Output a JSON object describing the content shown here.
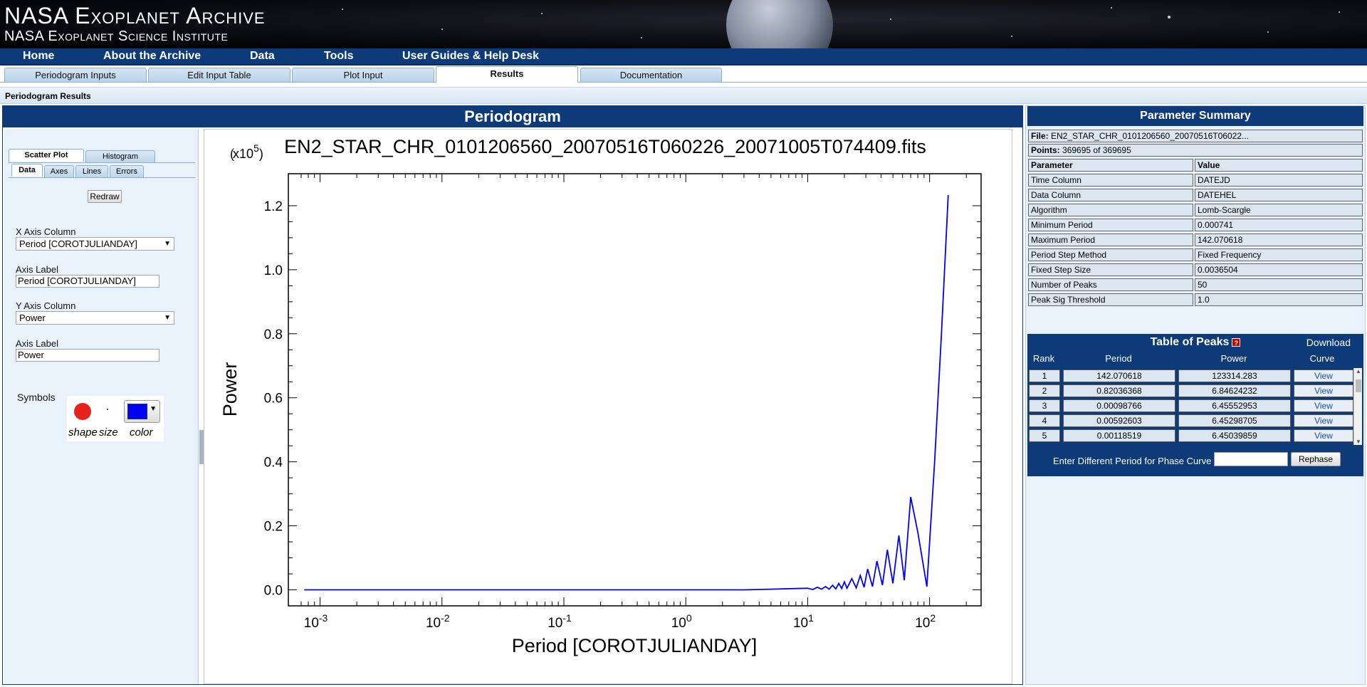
{
  "banner": {
    "title": "NASA Exoplanet Archive",
    "subtitle": "NASA Exoplanet Science Institute"
  },
  "nav": [
    "Home",
    "About the Archive",
    "Data",
    "Tools",
    "User Guides & Help Desk"
  ],
  "tabs": [
    "Periodogram Inputs",
    "Edit Input Table",
    "Plot Input",
    "Results",
    "Documentation"
  ],
  "active_tab": "Results",
  "subheader": "Periodogram Results",
  "periodogram": {
    "title": "Periodogram",
    "plot_tabs": [
      "Scatter Plot",
      "Histogram"
    ],
    "sub_tabs": [
      "Data",
      "Axes",
      "Lines",
      "Errors"
    ],
    "redraw": "Redraw",
    "x_axis_column_label": "X Axis Column",
    "x_axis_column_value": "Period [COROTJULIANDAY]",
    "x_axis_label_label": "Axis Label",
    "x_axis_label_value": "Period [COROTJULIANDAY]",
    "y_axis_column_label": "Y Axis Column",
    "y_axis_column_value": "Power",
    "y_axis_label_label": "Axis Label",
    "y_axis_label_value": "Power",
    "symbols_label": "Symbols",
    "sym_shape": "shape",
    "sym_size": "size",
    "sym_color": "color",
    "symbol_color": "#0000ff"
  },
  "chart_data": {
    "type": "line",
    "title": "EN2_STAR_CHR_0101206560_20070516T060226_20071005T074409.fits",
    "xlabel": "Period [COROTJULIANDAY]",
    "ylabel": "Power",
    "y_scale_base": "x10",
    "y_scale_exp": "5",
    "x_scale": "log",
    "xlim": [
      0.000741,
      142.070618
    ],
    "ylim": [
      -0.05,
      1.3
    ],
    "x_ticks": [
      "-3",
      "-2",
      "-1",
      "0",
      "1",
      "2"
    ],
    "y_ticks": [
      "0.0",
      "0.2",
      "0.4",
      "0.6",
      "0.8",
      "1.0",
      "1.2"
    ],
    "line_color": "#0000ff",
    "series": [
      {
        "x": [
          0.000741,
          0.01,
          0.1,
          1,
          3,
          5,
          8,
          10,
          11,
          12,
          13,
          14,
          15,
          16,
          17,
          18,
          19,
          20,
          21,
          23,
          25,
          27,
          29,
          31,
          34,
          37,
          41,
          45,
          50,
          56,
          62,
          70,
          80,
          95,
          110,
          125,
          142.07
        ],
        "y": [
          0,
          0,
          0,
          0,
          0,
          0.002,
          0.004,
          0.005,
          0.001,
          0.008,
          0.002,
          0.01,
          0.002,
          0.014,
          0.003,
          0.02,
          0.004,
          0.025,
          0.005,
          0.035,
          0.006,
          0.045,
          0.008,
          0.065,
          0.01,
          0.09,
          0.015,
          0.125,
          0.02,
          0.17,
          0.03,
          0.29,
          0.18,
          0.01,
          0.4,
          0.8,
          1.233
        ]
      }
    ]
  },
  "params": {
    "title": "Parameter Summary",
    "file_label": "File:",
    "file_value": "EN2_STAR_CHR_0101206560_20070516T06022...",
    "points_label": "Points:",
    "points_value": "369695 of 369695",
    "header": [
      "Parameter",
      "Value"
    ],
    "rows": [
      [
        "Time Column",
        "DATEJD"
      ],
      [
        "Data Column",
        "DATEHEL"
      ],
      [
        "Algorithm",
        "Lomb-Scargle"
      ],
      [
        "Minimum Period",
        "0.000741"
      ],
      [
        "Maximum Period",
        "142.070618"
      ],
      [
        "Period Step Method",
        "Fixed Frequency"
      ],
      [
        "Fixed Step Size",
        "0.0036504"
      ],
      [
        "Number of Peaks",
        "50"
      ],
      [
        "Peak Sig Threshold",
        "1.0"
      ]
    ]
  },
  "peaks": {
    "title": "Table of Peaks",
    "download": "Download",
    "headers": [
      "Rank",
      "Period",
      "Power",
      "Curve"
    ],
    "rows": [
      [
        "1",
        "142.070618",
        "123314.283",
        "View"
      ],
      [
        "2",
        "0.82036368",
        "6.84624232",
        "View"
      ],
      [
        "3",
        "0.00098766",
        "6.45552953",
        "View"
      ],
      [
        "4",
        "0.00592603",
        "6.45298705",
        "View"
      ],
      [
        "5",
        "0.00118519",
        "6.45039859",
        "View"
      ]
    ],
    "rephase_label": "Enter Different Period for Phase Curve",
    "rephase_value": "",
    "rephase_button": "Rephase"
  }
}
